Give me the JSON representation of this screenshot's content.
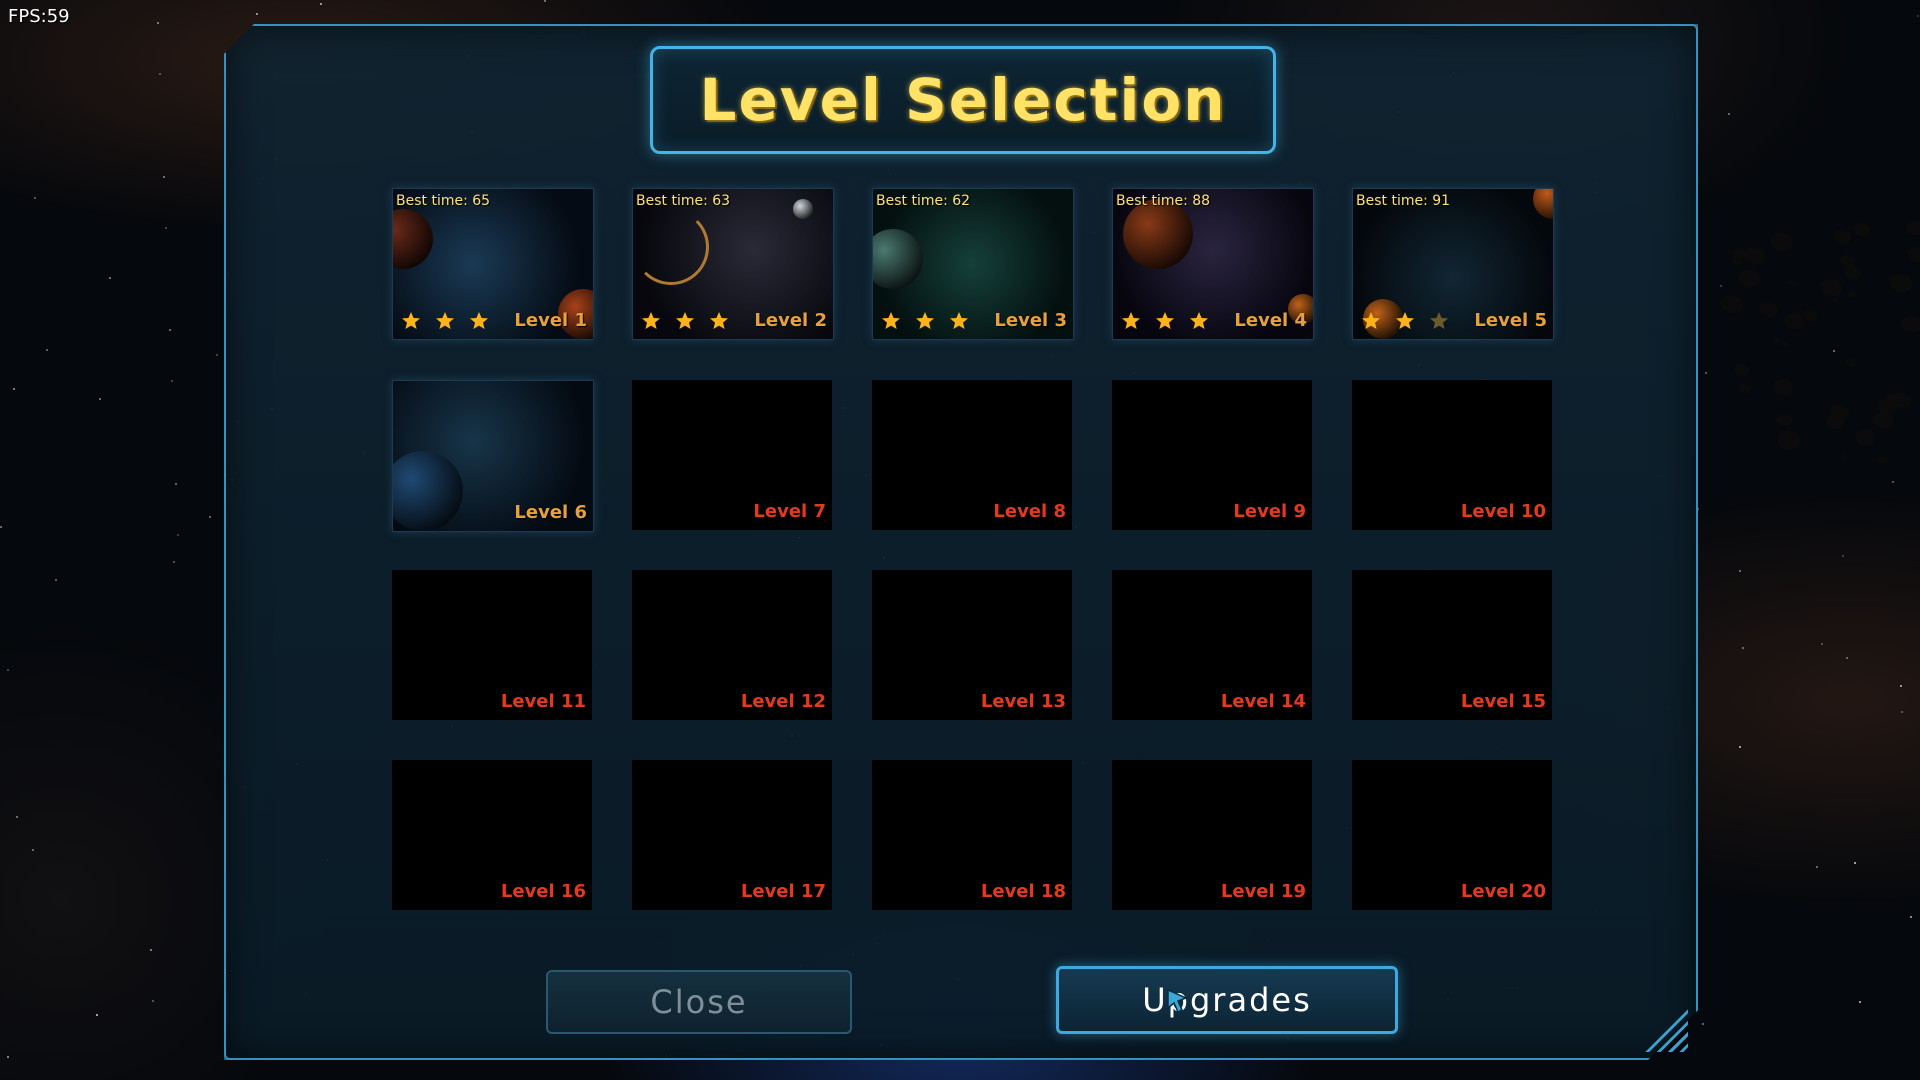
{
  "hud": {
    "fps": "FPS:59"
  },
  "title": "Level Selection",
  "levels": [
    {
      "label": "Level 1",
      "best": "Best time: 65",
      "stars": 3,
      "unlocked": true
    },
    {
      "label": "Level 2",
      "best": "Best time: 63",
      "stars": 3,
      "unlocked": true
    },
    {
      "label": "Level 3",
      "best": "Best time: 62",
      "stars": 3,
      "unlocked": true
    },
    {
      "label": "Level 4",
      "best": "Best time: 88",
      "stars": 3,
      "unlocked": true
    },
    {
      "label": "Level 5",
      "best": "Best time: 91",
      "stars": 2,
      "unlocked": true
    },
    {
      "label": "Level 6",
      "best": "",
      "stars": 0,
      "unlocked": true
    },
    {
      "label": "Level 7",
      "best": "",
      "stars": 0,
      "unlocked": false
    },
    {
      "label": "Level 8",
      "best": "",
      "stars": 0,
      "unlocked": false
    },
    {
      "label": "Level 9",
      "best": "",
      "stars": 0,
      "unlocked": false
    },
    {
      "label": "Level 10",
      "best": "",
      "stars": 0,
      "unlocked": false
    },
    {
      "label": "Level 11",
      "best": "",
      "stars": 0,
      "unlocked": false
    },
    {
      "label": "Level 12",
      "best": "",
      "stars": 0,
      "unlocked": false
    },
    {
      "label": "Level 13",
      "best": "",
      "stars": 0,
      "unlocked": false
    },
    {
      "label": "Level 14",
      "best": "",
      "stars": 0,
      "unlocked": false
    },
    {
      "label": "Level 15",
      "best": "",
      "stars": 0,
      "unlocked": false
    },
    {
      "label": "Level 16",
      "best": "",
      "stars": 0,
      "unlocked": false
    },
    {
      "label": "Level 17",
      "best": "",
      "stars": 0,
      "unlocked": false
    },
    {
      "label": "Level 18",
      "best": "",
      "stars": 0,
      "unlocked": false
    },
    {
      "label": "Level 19",
      "best": "",
      "stars": 0,
      "unlocked": false
    },
    {
      "label": "Level 20",
      "best": "",
      "stars": 0,
      "unlocked": false
    }
  ],
  "buttons": {
    "close": "Close",
    "upgrades": "Upgrades"
  },
  "colors": {
    "title_text": "#ffe266",
    "accent_border": "#42b4e6",
    "unlocked_label": "#e8a03a",
    "locked_label": "#e23a1e",
    "star_filled": "#ffb21a",
    "star_empty": "#6b5a2a"
  }
}
